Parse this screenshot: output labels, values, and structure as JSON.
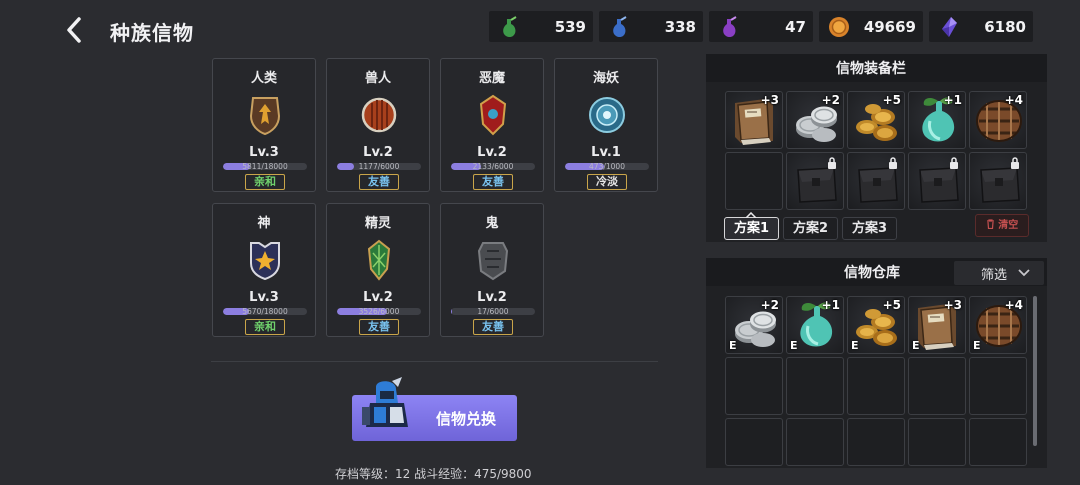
{
  "header": {
    "title": "种族信物",
    "currencies": [
      {
        "icon": "green-potion-icon",
        "value": "539"
      },
      {
        "icon": "blue-potion-icon",
        "value": "338"
      },
      {
        "icon": "purple-potion-icon",
        "value": "47"
      },
      {
        "icon": "gold-coin-icon",
        "value": "49669"
      },
      {
        "icon": "purple-crystal-icon",
        "value": "6180"
      }
    ]
  },
  "races": [
    {
      "name": "人类",
      "level": "Lv.3",
      "exp": "5811/18000",
      "progress": 0.32,
      "relation": "亲和",
      "relation_color": "green"
    },
    {
      "name": "兽人",
      "level": "Lv.2",
      "exp": "1177/6000",
      "progress": 0.2,
      "relation": "友善",
      "relation_color": "blue"
    },
    {
      "name": "恶魔",
      "level": "Lv.2",
      "exp": "2133/6000",
      "progress": 0.36,
      "relation": "友善",
      "relation_color": "blue"
    },
    {
      "name": "海妖",
      "level": "Lv.1",
      "exp": "473/1000",
      "progress": 0.47,
      "relation": "冷淡",
      "relation_color": "white"
    },
    {
      "name": "神",
      "level": "Lv.3",
      "exp": "5670/18000",
      "progress": 0.31,
      "relation": "亲和",
      "relation_color": "green"
    },
    {
      "name": "精灵",
      "level": "Lv.2",
      "exp": "3526/6000",
      "progress": 0.59,
      "relation": "友善",
      "relation_color": "blue"
    },
    {
      "name": "鬼",
      "level": "Lv.2",
      "exp": "17/6000",
      "progress": 0.01,
      "relation": "友善",
      "relation_color": "blue"
    }
  ],
  "exchange_button": {
    "label": "信物兑换"
  },
  "footer": {
    "text": "存档等级：12  战斗经验：475/9800"
  },
  "equip_panel": {
    "title": "信物装备栏",
    "slots_row1": [
      {
        "item": "book-icon",
        "plus": "+3"
      },
      {
        "item": "silver-coins-icon",
        "plus": "+2"
      },
      {
        "item": "gold-coins-icon",
        "plus": "+5"
      },
      {
        "item": "teal-flask-icon",
        "plus": "+1"
      },
      {
        "item": "barrel-shield-icon",
        "plus": "+4"
      }
    ],
    "plans": [
      "方案1",
      "方案2",
      "方案3"
    ],
    "active_plan": "方案1",
    "clear_label": "清空"
  },
  "warehouse_panel": {
    "title": "信物仓库",
    "filter_label": "筛选",
    "equipped_mark": "E",
    "items": [
      {
        "item": "silver-coins-icon",
        "plus": "+2"
      },
      {
        "item": "teal-flask-icon",
        "plus": "+1"
      },
      {
        "item": "gold-coins-icon",
        "plus": "+5"
      },
      {
        "item": "book-icon",
        "plus": "+3"
      },
      {
        "item": "barrel-shield-icon",
        "plus": "+4"
      }
    ]
  }
}
